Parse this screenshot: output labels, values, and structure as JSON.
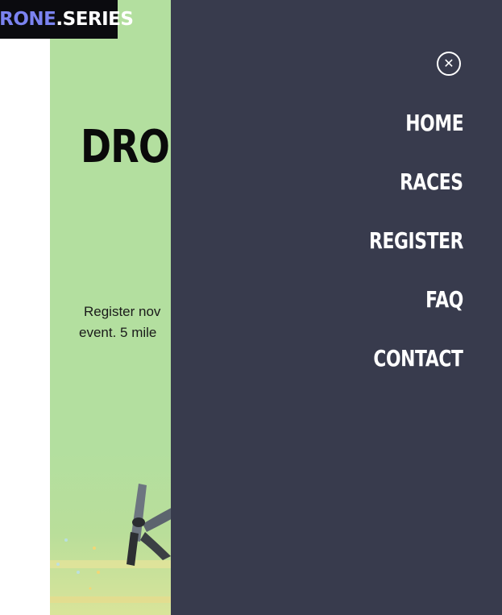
{
  "logo": {
    "brand": "DRONE",
    "separator": ".",
    "suffix": "SERIES"
  },
  "hero": {
    "title": "DRONI",
    "text_line1": "Register nov",
    "text_line2": "event. 5 mile"
  },
  "nav": {
    "close_icon": "close-circle-icon",
    "items": [
      {
        "label": "HOME"
      },
      {
        "label": "RACES"
      },
      {
        "label": "REGISTER"
      },
      {
        "label": "FAQ"
      },
      {
        "label": "CONTACT"
      }
    ]
  },
  "colors": {
    "panel_bg": "#383b4d",
    "hero_bg": "#b3df9f",
    "logo_bg": "#0b0b0f",
    "brand_accent": "#7b83f0"
  }
}
